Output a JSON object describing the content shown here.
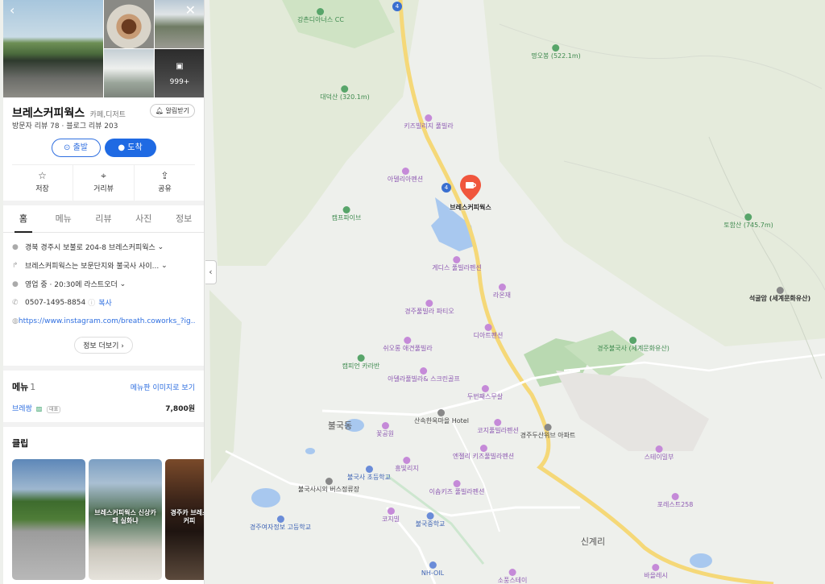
{
  "place": {
    "name": "브레스커피웍스",
    "category": "카페,디저트",
    "notify_label": "알림받기",
    "visitor_reviews": "방문자 리뷰 78",
    "blog_reviews": "블로그 리뷰 203",
    "photo_more": "999+"
  },
  "directions": {
    "start": "출발",
    "arrive": "도착"
  },
  "actions": [
    {
      "label": "저장",
      "icon": "star-icon"
    },
    {
      "label": "거리뷰",
      "icon": "pin-icon"
    },
    {
      "label": "공유",
      "icon": "share-icon"
    }
  ],
  "tabs": [
    "홈",
    "메뉴",
    "리뷰",
    "사진",
    "정보"
  ],
  "info": {
    "address": "경북 경주시 보불로 204-8 브레스커피웍스",
    "directions_text": "브레스커피웍스는 보문단지와 불국사 사이...",
    "hours": "영업 중 · 20:30에 라스트오더",
    "phone": "0507-1495-8854",
    "copy_label": "복사",
    "website": "https://www.instagram.com/breath.coworks_?ig...",
    "more_label": "정보 더보기"
  },
  "menu": {
    "title": "메뉴",
    "count": "1",
    "link_label": "메뉴판 이미지로 보기",
    "items": [
      {
        "name": "브레쌍",
        "badge": "대표",
        "price": "7,800원"
      }
    ]
  },
  "clips": {
    "title": "클립",
    "items": [
      {
        "text": ""
      },
      {
        "text": "브레스커피웍스 신상카페 실화냐"
      },
      {
        "text": "경주카 브레스커피"
      }
    ]
  },
  "map": {
    "marker_label": "브레스커피웍스",
    "route_number": "4",
    "labels": [
      {
        "text": "강촌디아너스 CC",
        "kind": "green"
      },
      {
        "text": "명오봉 (522.1m)",
        "kind": "green"
      },
      {
        "text": "대덕산 (320.1m)",
        "kind": "green"
      },
      {
        "text": "키즈빌리지 풀빌라",
        "kind": "purple"
      },
      {
        "text": "아델리아펜션",
        "kind": "purple"
      },
      {
        "text": "캠프파이브",
        "kind": "green"
      },
      {
        "text": "토함산 (745.7m)",
        "kind": "green"
      },
      {
        "text": "게디스 풀빌라펜션",
        "kind": "purple"
      },
      {
        "text": "라온재",
        "kind": "purple"
      },
      {
        "text": "석굴암 (세계문화유산)",
        "kind": "dark"
      },
      {
        "text": "경주풀빌라 파티오",
        "kind": "purple"
      },
      {
        "text": "디아트펜션",
        "kind": "purple"
      },
      {
        "text": "쉬오롱 애견풀빌라",
        "kind": "purple"
      },
      {
        "text": "경주불국사 (세계문화유산)",
        "kind": "green"
      },
      {
        "text": "캠피언 카라반",
        "kind": "green"
      },
      {
        "text": "아델라풀빌라& 스크린골프",
        "kind": "purple"
      },
      {
        "text": "두번째스무살",
        "kind": "purple"
      },
      {
        "text": "불국동",
        "kind": "big"
      },
      {
        "text": "산속한옥마을 Hotel",
        "kind": "grey"
      },
      {
        "text": "코지풀빌라펜션",
        "kind": "purple"
      },
      {
        "text": "경주두산위브 아파트",
        "kind": "grey"
      },
      {
        "text": "꽃공원",
        "kind": "purple"
      },
      {
        "text": "스테이밀부",
        "kind": "purple"
      },
      {
        "text": "엔젤리 키즈풀빌라펜션",
        "kind": "purple"
      },
      {
        "text": "흥빛리지",
        "kind": "purple"
      },
      {
        "text": "불국사 초등학교",
        "kind": "blue"
      },
      {
        "text": "불국사시외 버스정류장",
        "kind": "grey"
      },
      {
        "text": "이솝키즈 풀빌라펜션",
        "kind": "purple"
      },
      {
        "text": "포레스트258",
        "kind": "purple"
      },
      {
        "text": "코지빌",
        "kind": "purple"
      },
      {
        "text": "불국중학교",
        "kind": "blue"
      },
      {
        "text": "경주여자정보 고등학교",
        "kind": "blue"
      },
      {
        "text": "신계리",
        "kind": "big"
      },
      {
        "text": "NH-OIL",
        "kind": "blue"
      },
      {
        "text": "소풍스테이",
        "kind": "purple"
      },
      {
        "text": "바을레시",
        "kind": "purple"
      }
    ]
  }
}
